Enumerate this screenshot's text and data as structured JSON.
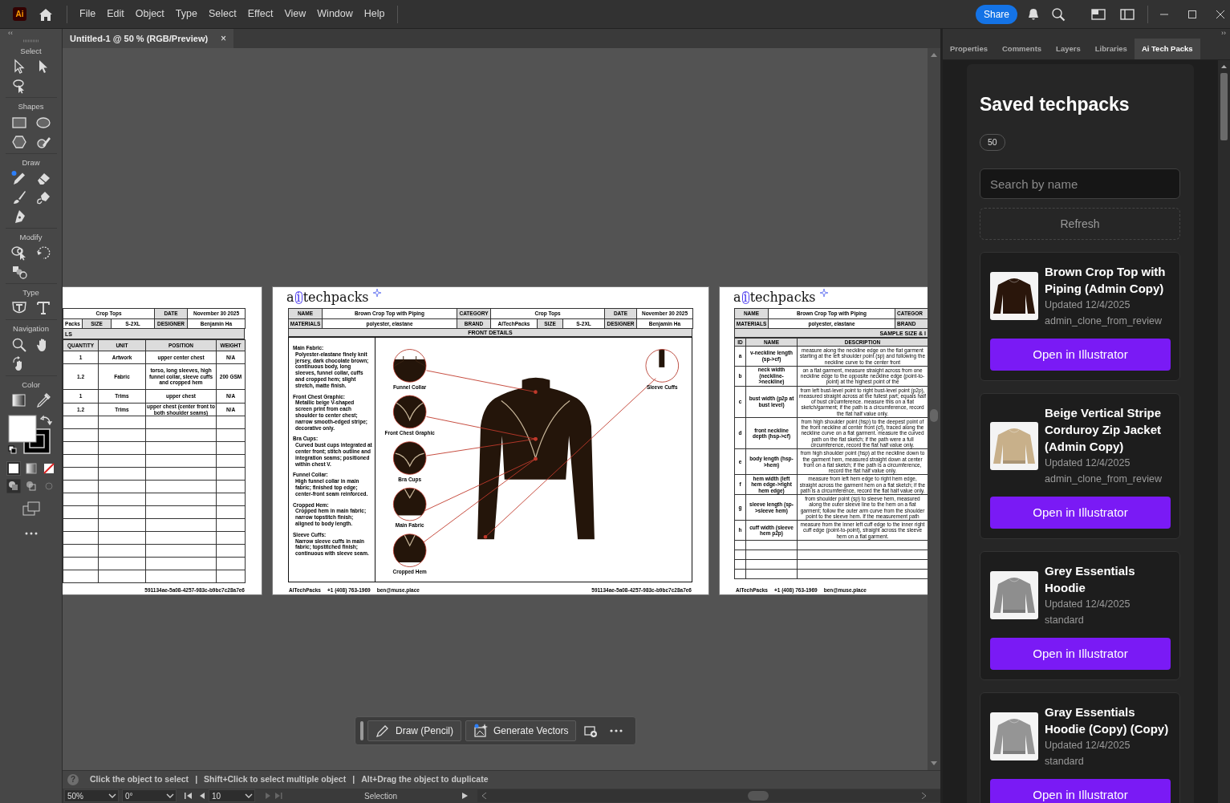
{
  "app": {
    "logo": "Ai",
    "menu": [
      "File",
      "Edit",
      "Object",
      "Type",
      "Select",
      "Effect",
      "View",
      "Window",
      "Help"
    ],
    "share": "Share"
  },
  "document_tab": {
    "title": "Untitled-1 @ 50 % (RGB/Preview)",
    "close": "×"
  },
  "tools_panel": {
    "collapse": "‹‹",
    "sections": [
      "Select",
      "Shapes",
      "Draw",
      "Modify",
      "Type",
      "Navigation",
      "Color"
    ]
  },
  "artboards": [
    {
      "kind": "bom",
      "header_rows": [
        [
          {
            "text": "Crop Tops",
            "kind": "value"
          },
          {
            "text": "DATE",
            "kind": "label"
          },
          {
            "text": "November 30 2025",
            "kind": "value"
          }
        ],
        [
          {
            "text": "Packs",
            "kind": "value"
          },
          {
            "text": "SIZE",
            "kind": "label"
          },
          {
            "text": "S-2XL",
            "kind": "value"
          },
          {
            "text": "DESIGNER",
            "kind": "label"
          },
          {
            "text": "Benjamin Ha",
            "kind": "value"
          }
        ]
      ],
      "section": "LS",
      "columns": [
        "QUANTITY",
        "UNIT",
        "POSITION",
        "WEIGHT"
      ],
      "rows": [
        [
          "1",
          "Artwork",
          "upper center chest",
          "N/A"
        ],
        [
          "1.2",
          "Fabric",
          "torso, long sleeves, high funnel collar, sleeve cuffs and cropped hem",
          "200 GSM"
        ],
        [
          "1",
          "Trims",
          "upper chest",
          "N/A"
        ],
        [
          "1.2",
          "Trims",
          "upper chest (center front to both shoulder seams)",
          "N/A"
        ]
      ],
      "id": "591134ae-5a08-4257-983c-b9bc7c28a7e6"
    },
    {
      "kind": "front_details",
      "logo": "aitechpacks",
      "header_rows": [
        [
          {
            "text": "NAME",
            "kind": "label"
          },
          {
            "text": "Brown Crop Top with Piping",
            "kind": "value"
          },
          {
            "text": "CATEGORY",
            "kind": "label"
          },
          {
            "text": "Crop Tops",
            "kind": "value"
          },
          {
            "text": "DATE",
            "kind": "label"
          },
          {
            "text": "November 30 2025",
            "kind": "value"
          }
        ],
        [
          {
            "text": "MATERIALS",
            "kind": "label"
          },
          {
            "text": "polyester, elastane",
            "kind": "value"
          },
          {
            "text": "BRAND",
            "kind": "label"
          },
          {
            "text": "AITechPacks",
            "kind": "value"
          },
          {
            "text": "SIZE",
            "kind": "label"
          },
          {
            "text": "S-2XL",
            "kind": "value"
          },
          {
            "text": "DESIGNER",
            "kind": "label"
          },
          {
            "text": "Benjamin Ha",
            "kind": "value"
          }
        ]
      ],
      "section": "FRONT DETAILS",
      "notes": [
        {
          "title": "Main Fabric:",
          "text": "Polyester-elastane finely knit jersey, dark chocolate brown; continuous body, long sleeves, funnel collar, cuffs and cropped hem; slight stretch, matte finish."
        },
        {
          "title": "Front Chest Graphic:",
          "text": "Metallic beige V-shaped screen print from each shoulder to center chest; narrow smooth-edged stripe; decorative only."
        },
        {
          "title": "Bra Cups:",
          "text": "Curved bust cups integrated at center front; stitch outline and integration seams; positioned within chest V."
        },
        {
          "title": "Funnel Collar:",
          "text": "High funnel collar in main fabric; finished top edge; center-front seam reinforced."
        },
        {
          "title": "Cropped Hem:",
          "text": "Cropped hem in main fabric; narrow topstitch finish; aligned to body length."
        },
        {
          "title": "Sleeve Cuffs:",
          "text": "Narrow sleeve cuffs in main fabric; topstitched finish; continuous with sleeve seam."
        }
      ],
      "callouts": [
        "Funnel Collar",
        "Front Chest Graphic",
        "Bra Cups",
        "Main Fabric",
        "Cropped Hem",
        "Sleeve Cuffs"
      ],
      "footer": [
        "AITechPacks",
        "+1 (408) 763-1969",
        "ben@muse.place"
      ],
      "id": "591134ae-5a08-4257-983c-b9bc7c28a7e6"
    },
    {
      "kind": "measurements",
      "logo": "aitechpacks",
      "header_rows": [
        [
          {
            "text": "NAME",
            "kind": "label"
          },
          {
            "text": "Brown Crop Top with Piping",
            "kind": "value"
          },
          {
            "text": "CATEGOR",
            "kind": "label"
          }
        ],
        [
          {
            "text": "MATERIALS",
            "kind": "label"
          },
          {
            "text": "polyester, elastane",
            "kind": "value"
          },
          {
            "text": "BRAND",
            "kind": "label"
          }
        ]
      ],
      "section": "SAMPLE SIZE & I",
      "columns": [
        "ID",
        "NAME",
        "DESCRIPTION"
      ],
      "rows": [
        {
          "id": "a",
          "name": "v-neckline length (sp->cf)",
          "description": [
            "measure along the neckline edge on the flat garment starting at the left",
            "shoulder point (sp) and following the neckline curve to the center front"
          ]
        },
        {
          "id": "b",
          "name": "neck width (neckline->neckline)",
          "description": [
            "on a flat garment, measure straight across from one neckline edge to",
            "the opposite neckline edge (point-to-point) at the highest point of the"
          ]
        },
        {
          "id": "c",
          "name": "bust width (p2p at bust level)",
          "description": [
            "from left bust-level point to right bust-level point (p2p), measured",
            "straight across at the fullest part; equals half of bust circumference.",
            "measure this on a flat sketch/garment; if the path is a circumference,",
            "record the flat half value only."
          ]
        },
        {
          "id": "d",
          "name": "front neckline depth (hsp->cf)",
          "description": [
            "from high shoulder point (hsp) to the deepest point of the front neckline",
            "at center front (cf), traced along the neckline curve on a flat garment.",
            "measure the curved path on the flat sketch; if the path were a full",
            "circumference, record the flat half value only."
          ]
        },
        {
          "id": "e",
          "name": "body length (hsp->hem)",
          "description": [
            "from high shoulder point (hsp) at the neckline down to the garment",
            "hem, measured straight down at center front on a flat sketch; if the",
            "path is a circumference, record the flat half value only."
          ]
        },
        {
          "id": "f",
          "name": "hem width (left hem edge->right hem edge)",
          "description": [
            "measure from left hem edge to right hem edge, straight across the",
            "garment hem on a flat sketch; if the path is a circumference, record the",
            "flat half value only."
          ]
        },
        {
          "id": "g",
          "name": "sleeve length (sp->sleeve hem)",
          "description": [
            "from shoulder point (sp) to sleeve hem, measured along the outer",
            "sleeve line to the hem on a flat garment; follow the outer arm curve",
            "from the shoulder point to the sleeve hem. If the measurement path"
          ]
        },
        {
          "id": "h",
          "name": "cuff width (sleeve hem p2p)",
          "description": [
            "measure from the inner left cuff edge to the inner right cuff edge",
            "(point-to-point), straight across the sleeve hem on a flat garment."
          ]
        }
      ],
      "footer": [
        "AITechPacks",
        "+1 (408) 763-1969",
        "ben@muse.place"
      ]
    }
  ],
  "floating_toolbar": {
    "buttons": [
      "Draw (Pencil)",
      "Generate Vectors"
    ]
  },
  "hint_bar": {
    "help": "?",
    "hints": [
      "Click the object to select",
      "|",
      "Shift+Click to select multiple object",
      "|",
      "Alt+Drag the object to duplicate"
    ]
  },
  "status_bar": {
    "zoom": "50%",
    "rotation": "0°",
    "artboard": "10",
    "tool": "Selection"
  },
  "right_panel": {
    "collapse": "››",
    "tabs": [
      {
        "label": "Properties",
        "selected": false
      },
      {
        "label": "Comments",
        "selected": false
      },
      {
        "label": "Layers",
        "selected": false
      },
      {
        "label": "Libraries",
        "selected": false
      },
      {
        "label": "Ai Tech Packs",
        "selected": true
      }
    ],
    "title": "Saved techpacks",
    "count": "50",
    "search": {
      "placeholder": "Search by name"
    },
    "refresh": "Refresh",
    "techpacks": [
      {
        "title": "Brown Crop Top with Piping (Admin Copy)",
        "updated": "Updated 12/4/2025",
        "source": "admin_clone_from_review",
        "button": "Open in Illustrator"
      },
      {
        "title": "Beige Vertical Stripe Corduroy Zip Jacket (Admin Copy)",
        "updated": "Updated 12/4/2025",
        "source": "admin_clone_from_review",
        "button": "Open in Illustrator"
      },
      {
        "title": "Grey Essentials Hoodie",
        "updated": "Updated 12/4/2025",
        "source": "standard",
        "button": "Open in Illustrator"
      },
      {
        "title": "Gray Essentials Hoodie (Copy) (Copy)",
        "updated": "Updated 12/4/2025",
        "source": "standard",
        "button": "Open in Illustrator"
      }
    ]
  }
}
